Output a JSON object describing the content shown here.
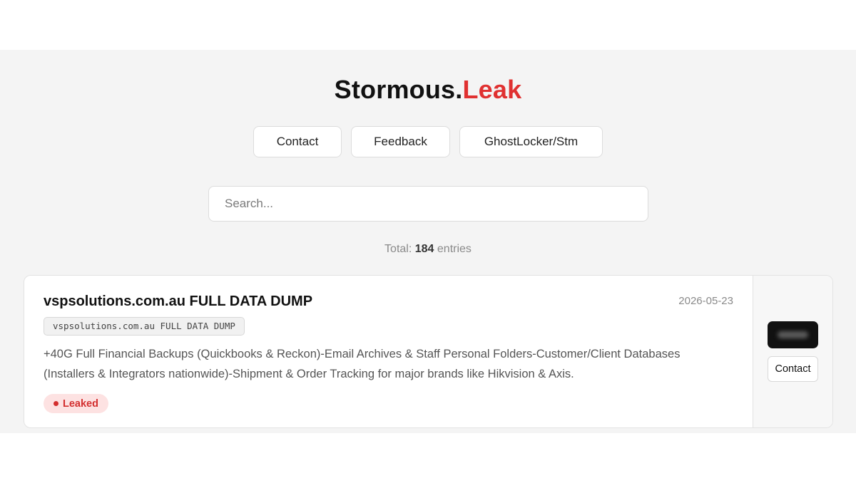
{
  "header": {
    "title_main": "Stormous.",
    "title_accent": "Leak",
    "accent_color": "#e03131"
  },
  "nav": {
    "contact_label": "Contact",
    "feedback_label": "Feedback",
    "ghostlocker_label": "GhostLocker/Stm"
  },
  "search": {
    "placeholder": "Search...",
    "value": ""
  },
  "summary": {
    "total_prefix": "Total:",
    "total_count": "184",
    "total_suffix": "entries"
  },
  "entries": [
    {
      "title": "vspsolutions.com.au FULL DATA DUMP",
      "date": "2026-05-23",
      "code": "vspsolutions.com.au FULL DATA DUMP",
      "description": "+40G Full Financial Backups (Quickbooks & Reckon)-Email Archives & Staff Personal Folders-Customer/Client Databases (Installers & Integrators nationwide)-Shipment & Order Tracking for major brands like Hikvision & Axis.",
      "status": "Leaked",
      "status_color": "#d32f2f",
      "contact_label": "Contact"
    }
  ]
}
